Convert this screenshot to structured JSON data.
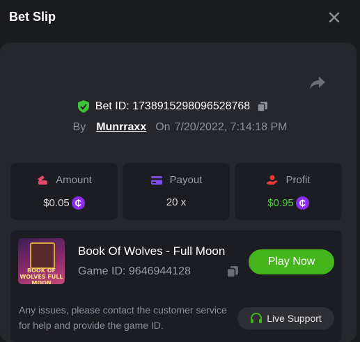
{
  "header": {
    "title": "Bet Slip"
  },
  "bet": {
    "id_text": "Bet ID: 1738915298096528768",
    "by_label": "By",
    "username": "Munrraxx",
    "on_label": "On",
    "datetime": "7/20/2022, 7:14:18 PM"
  },
  "stats": {
    "amount": {
      "label": "Amount",
      "value": "$0.05"
    },
    "payout": {
      "label": "Payout",
      "value": "20 x"
    },
    "profit": {
      "label": "Profit",
      "value": "$0.95"
    }
  },
  "coin_symbol": "₵",
  "game": {
    "name": "Book Of Wolves - Full Moon",
    "id_text": "Game ID: 9646944128",
    "thumb_text": "BOOK OF WOLVES FULL MOON",
    "play_label": "Play Now"
  },
  "support": {
    "note": "Any issues, please contact the customer service for help and provide the game ID.",
    "button_label": "Live Support"
  },
  "colors": {
    "accent_green": "#46b51c",
    "coin_purple": "#8b2cf0",
    "profit_green": "#4cd13b"
  }
}
